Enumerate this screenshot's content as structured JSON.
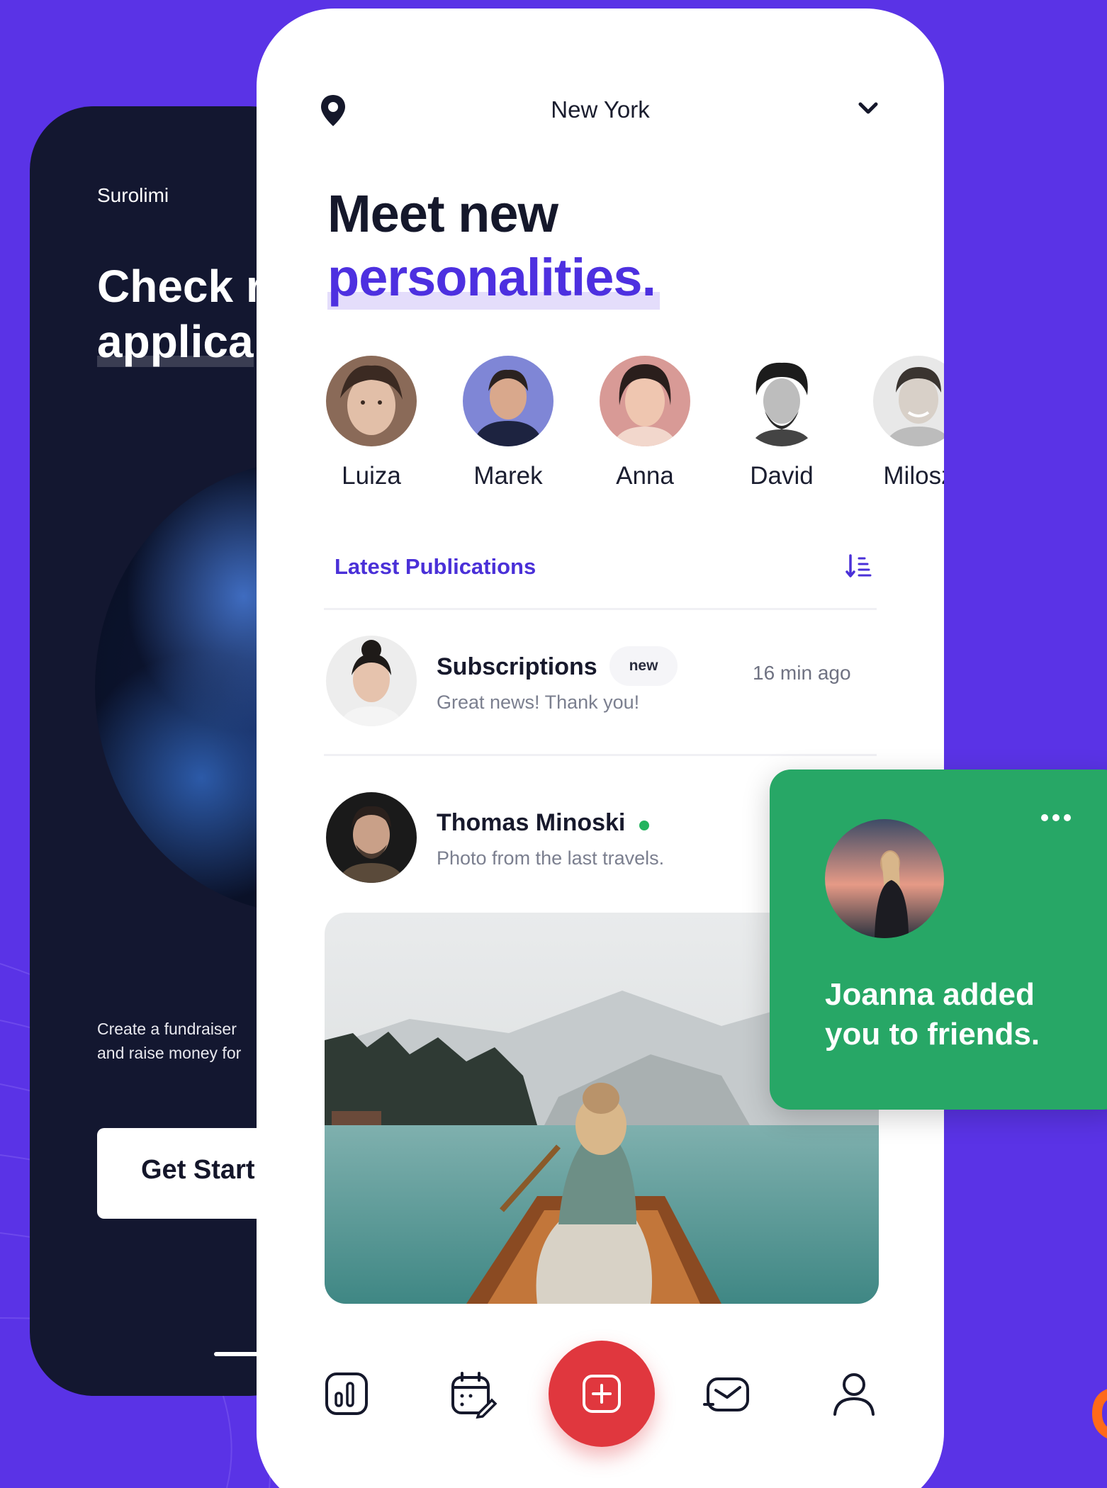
{
  "background_color": "#5a33e6",
  "back_screen": {
    "brand": "Surolimi",
    "title_line1": "Check r",
    "title_line2": "applica",
    "description_line1": "Create a fundraiser",
    "description_line2": "and raise money for",
    "cta_label": "Get Start"
  },
  "header": {
    "location_icon": "map-pin-icon",
    "city": "New York",
    "dropdown_icon": "chevron-down-icon"
  },
  "hero": {
    "line1": "Meet new",
    "line2": "personalities."
  },
  "people": [
    {
      "name": "Luiza"
    },
    {
      "name": "Marek"
    },
    {
      "name": "Anna"
    },
    {
      "name": "David"
    },
    {
      "name": "Milosz"
    }
  ],
  "publications": {
    "label": "Latest Publications",
    "sort_icon": "sort-icon",
    "items": [
      {
        "title": "Subscriptions",
        "badge": "new",
        "subtitle": "Great news! Thank you!",
        "time": "16 min ago"
      },
      {
        "title": "Thomas Minoski",
        "subtitle": "Photo from the last travels.",
        "online": true
      }
    ]
  },
  "bottom_nav": {
    "items": [
      "chart-icon",
      "calendar-icon",
      "add-icon",
      "message-icon",
      "profile-icon"
    ],
    "accent_color": "#e0373e"
  },
  "notification": {
    "text_line1": "Joanna added",
    "text_line2": "you to friends.",
    "menu_icon": "more-icon",
    "color": "#27a766"
  },
  "accent_color": "#4d30e0"
}
